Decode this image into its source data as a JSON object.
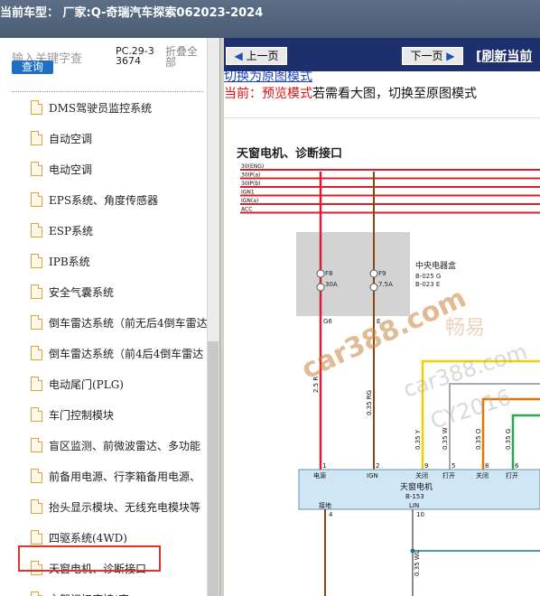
{
  "title": "当前车型：  厂家:Q-奇瑞汽车探索062023-2024",
  "search": {
    "placeholder": "输入关键字查",
    "button": "查询",
    "pc_code": "PC.29-33674",
    "fold_label": "折叠全部"
  },
  "tree_items": [
    "DMS驾驶员监控系统",
    "自动空调",
    "电动空调",
    "EPS系统、角度传感器",
    "ESP系统",
    "IPB系统",
    "安全气囊系统",
    "倒车雷达系统（前无后4倒车雷达",
    "倒车雷达系统（前4后4倒车雷达",
    "电动尾门(PLG)",
    "车门控制模块",
    "盲区监测、前微波雷达、多功能",
    "前备用电源、行李箱备用电源、",
    "抬头显示模块、无线充电模块等",
    "四驱系统(4WD)",
    "天窗电机、诊断接口",
    "主驾记忆座椅(底"
  ],
  "selected_index": 15,
  "toolbar": {
    "prev": "上一页",
    "next": "下一页",
    "refresh": "[刷新当前"
  },
  "view": {
    "switch_link": "切换为原图模式",
    "current_prefix": "当前：",
    "current_mode": "预览模式",
    "hint": "若需看大图，切换至原图模式"
  },
  "diagram": {
    "title": "天窗电机、诊断接口",
    "power_rails": [
      "30(ENG)",
      "30IP(a)",
      "30IP(b)",
      "IGN1",
      "IGN(a)",
      "ACC"
    ],
    "junction_box": "中央电器盒",
    "jb_connectors": [
      "B-025 G",
      "B-023 E"
    ],
    "fuses": [
      {
        "id": "F8",
        "rating": "30A",
        "pin": "G6"
      },
      {
        "id": "F9",
        "rating": "7.5A",
        "pin": "E"
      }
    ],
    "wire_labels": [
      "2.5 R",
      "0.35 RG",
      "0.35 Y",
      "0.35 W",
      "0.35 O",
      "0.35 G",
      "0.35 WL"
    ],
    "module": {
      "name": "天窗电机",
      "connector": "B-153",
      "pins": [
        "电源",
        "IGN",
        "关闭",
        "打开",
        "关闭",
        "打开"
      ],
      "pin_numbers": [
        "1",
        "2",
        "9",
        "5",
        "8",
        "6"
      ],
      "ground_label": "接地",
      "ground_pin": "4",
      "lin_label": "LIN",
      "lin_pin": "10"
    },
    "watermarks": [
      "car388.com",
      "畅易",
      "car388.com",
      "CY2016"
    ]
  },
  "colors": {
    "rail": "#d8202c",
    "brown": "#8b4513",
    "yellow": "#f0d000",
    "orange": "#e07800",
    "green": "#2aa84a",
    "gray_wire": "#8c8c8c",
    "teal": "#1a7c7c",
    "module_fill": "#cfe6f5"
  }
}
